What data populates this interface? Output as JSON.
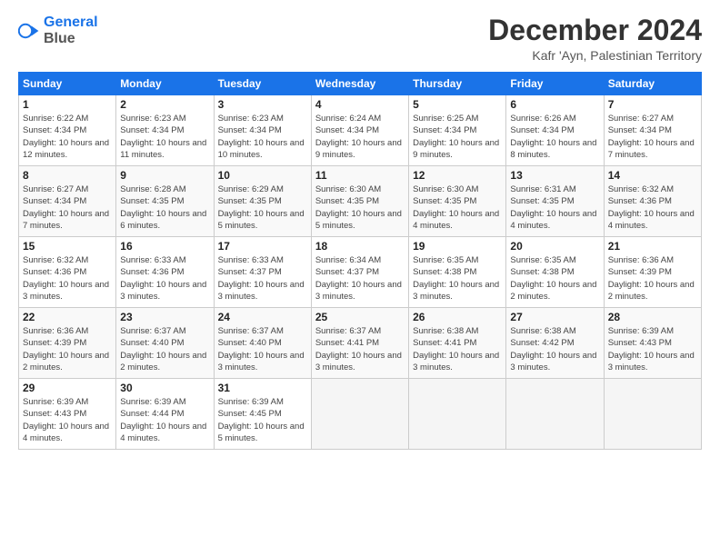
{
  "logo": {
    "line1": "General",
    "line2": "Blue"
  },
  "title": "December 2024",
  "subtitle": "Kafr 'Ayn, Palestinian Territory",
  "weekdays": [
    "Sunday",
    "Monday",
    "Tuesday",
    "Wednesday",
    "Thursday",
    "Friday",
    "Saturday"
  ],
  "weeks": [
    [
      {
        "day": "1",
        "sunrise": "6:22 AM",
        "sunset": "4:34 PM",
        "daylight": "10 hours and 12 minutes."
      },
      {
        "day": "2",
        "sunrise": "6:23 AM",
        "sunset": "4:34 PM",
        "daylight": "10 hours and 11 minutes."
      },
      {
        "day": "3",
        "sunrise": "6:23 AM",
        "sunset": "4:34 PM",
        "daylight": "10 hours and 10 minutes."
      },
      {
        "day": "4",
        "sunrise": "6:24 AM",
        "sunset": "4:34 PM",
        "daylight": "10 hours and 9 minutes."
      },
      {
        "day": "5",
        "sunrise": "6:25 AM",
        "sunset": "4:34 PM",
        "daylight": "10 hours and 9 minutes."
      },
      {
        "day": "6",
        "sunrise": "6:26 AM",
        "sunset": "4:34 PM",
        "daylight": "10 hours and 8 minutes."
      },
      {
        "day": "7",
        "sunrise": "6:27 AM",
        "sunset": "4:34 PM",
        "daylight": "10 hours and 7 minutes."
      }
    ],
    [
      {
        "day": "8",
        "sunrise": "6:27 AM",
        "sunset": "4:34 PM",
        "daylight": "10 hours and 7 minutes."
      },
      {
        "day": "9",
        "sunrise": "6:28 AM",
        "sunset": "4:35 PM",
        "daylight": "10 hours and 6 minutes."
      },
      {
        "day": "10",
        "sunrise": "6:29 AM",
        "sunset": "4:35 PM",
        "daylight": "10 hours and 5 minutes."
      },
      {
        "day": "11",
        "sunrise": "6:30 AM",
        "sunset": "4:35 PM",
        "daylight": "10 hours and 5 minutes."
      },
      {
        "day": "12",
        "sunrise": "6:30 AM",
        "sunset": "4:35 PM",
        "daylight": "10 hours and 4 minutes."
      },
      {
        "day": "13",
        "sunrise": "6:31 AM",
        "sunset": "4:35 PM",
        "daylight": "10 hours and 4 minutes."
      },
      {
        "day": "14",
        "sunrise": "6:32 AM",
        "sunset": "4:36 PM",
        "daylight": "10 hours and 4 minutes."
      }
    ],
    [
      {
        "day": "15",
        "sunrise": "6:32 AM",
        "sunset": "4:36 PM",
        "daylight": "10 hours and 3 minutes."
      },
      {
        "day": "16",
        "sunrise": "6:33 AM",
        "sunset": "4:36 PM",
        "daylight": "10 hours and 3 minutes."
      },
      {
        "day": "17",
        "sunrise": "6:33 AM",
        "sunset": "4:37 PM",
        "daylight": "10 hours and 3 minutes."
      },
      {
        "day": "18",
        "sunrise": "6:34 AM",
        "sunset": "4:37 PM",
        "daylight": "10 hours and 3 minutes."
      },
      {
        "day": "19",
        "sunrise": "6:35 AM",
        "sunset": "4:38 PM",
        "daylight": "10 hours and 3 minutes."
      },
      {
        "day": "20",
        "sunrise": "6:35 AM",
        "sunset": "4:38 PM",
        "daylight": "10 hours and 2 minutes."
      },
      {
        "day": "21",
        "sunrise": "6:36 AM",
        "sunset": "4:39 PM",
        "daylight": "10 hours and 2 minutes."
      }
    ],
    [
      {
        "day": "22",
        "sunrise": "6:36 AM",
        "sunset": "4:39 PM",
        "daylight": "10 hours and 2 minutes."
      },
      {
        "day": "23",
        "sunrise": "6:37 AM",
        "sunset": "4:40 PM",
        "daylight": "10 hours and 2 minutes."
      },
      {
        "day": "24",
        "sunrise": "6:37 AM",
        "sunset": "4:40 PM",
        "daylight": "10 hours and 3 minutes."
      },
      {
        "day": "25",
        "sunrise": "6:37 AM",
        "sunset": "4:41 PM",
        "daylight": "10 hours and 3 minutes."
      },
      {
        "day": "26",
        "sunrise": "6:38 AM",
        "sunset": "4:41 PM",
        "daylight": "10 hours and 3 minutes."
      },
      {
        "day": "27",
        "sunrise": "6:38 AM",
        "sunset": "4:42 PM",
        "daylight": "10 hours and 3 minutes."
      },
      {
        "day": "28",
        "sunrise": "6:39 AM",
        "sunset": "4:43 PM",
        "daylight": "10 hours and 3 minutes."
      }
    ],
    [
      {
        "day": "29",
        "sunrise": "6:39 AM",
        "sunset": "4:43 PM",
        "daylight": "10 hours and 4 minutes."
      },
      {
        "day": "30",
        "sunrise": "6:39 AM",
        "sunset": "4:44 PM",
        "daylight": "10 hours and 4 minutes."
      },
      {
        "day": "31",
        "sunrise": "6:39 AM",
        "sunset": "4:45 PM",
        "daylight": "10 hours and 5 minutes."
      },
      null,
      null,
      null,
      null
    ]
  ],
  "labels": {
    "sunrise": "Sunrise:",
    "sunset": "Sunset:",
    "daylight": "Daylight:"
  }
}
